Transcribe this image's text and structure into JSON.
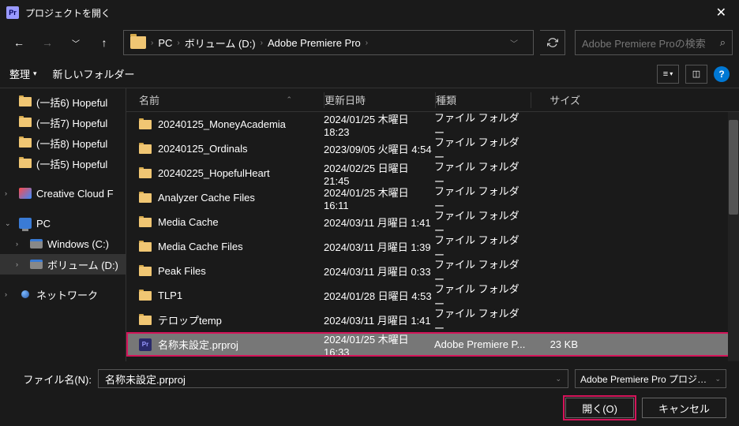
{
  "window": {
    "title": "プロジェクトを開く"
  },
  "breadcrumb": {
    "items": [
      "PC",
      "ボリューム (D:)",
      "Adobe Premiere Pro"
    ]
  },
  "search": {
    "placeholder": "Adobe Premiere Proの検索"
  },
  "toolbar": {
    "organize": "整理",
    "newfolder": "新しいフォルダー"
  },
  "sidebar": {
    "folders": [
      "(一括6) Hopeful",
      "(一括7) Hopeful",
      "(一括8) Hopeful",
      "(一括5) Hopeful"
    ],
    "cc": "Creative Cloud F",
    "pc": "PC",
    "drives": [
      "Windows (C:)",
      "ボリューム (D:)"
    ],
    "network": "ネットワーク"
  },
  "columns": {
    "name": "名前",
    "date": "更新日時",
    "type": "種類",
    "size": "サイズ"
  },
  "files": [
    {
      "name": "20240125_MoneyAcademia",
      "date": "2024/01/25 木曜日 18:23",
      "type": "ファイル フォルダー",
      "size": "",
      "kind": "folder"
    },
    {
      "name": "20240125_Ordinals",
      "date": "2023/09/05 火曜日 4:54",
      "type": "ファイル フォルダー",
      "size": "",
      "kind": "folder"
    },
    {
      "name": "20240225_HopefulHeart",
      "date": "2024/02/25 日曜日 21:45",
      "type": "ファイル フォルダー",
      "size": "",
      "kind": "folder"
    },
    {
      "name": "Analyzer Cache Files",
      "date": "2024/01/25 木曜日 16:11",
      "type": "ファイル フォルダー",
      "size": "",
      "kind": "folder"
    },
    {
      "name": "Media Cache",
      "date": "2024/03/11 月曜日 1:41",
      "type": "ファイル フォルダー",
      "size": "",
      "kind": "folder"
    },
    {
      "name": "Media Cache Files",
      "date": "2024/03/11 月曜日 1:39",
      "type": "ファイル フォルダー",
      "size": "",
      "kind": "folder"
    },
    {
      "name": "Peak Files",
      "date": "2024/03/11 月曜日 0:33",
      "type": "ファイル フォルダー",
      "size": "",
      "kind": "folder"
    },
    {
      "name": "TLP1",
      "date": "2024/01/28 日曜日 4:53",
      "type": "ファイル フォルダー",
      "size": "",
      "kind": "folder"
    },
    {
      "name": "テロップtemp",
      "date": "2024/03/11 月曜日 1:41",
      "type": "ファイル フォルダー",
      "size": "",
      "kind": "folder"
    },
    {
      "name": "名称未設定.prproj",
      "date": "2024/01/25 木曜日 16:33",
      "type": "Adobe Premiere P...",
      "size": "23 KB",
      "kind": "prproj",
      "selected": true
    }
  ],
  "footer": {
    "filename_label": "ファイル名(N):",
    "filename_value": "名称未設定.prproj",
    "filter": "Adobe Premiere Pro プロジェクト",
    "open": "開く(O)",
    "cancel": "キャンセル"
  }
}
